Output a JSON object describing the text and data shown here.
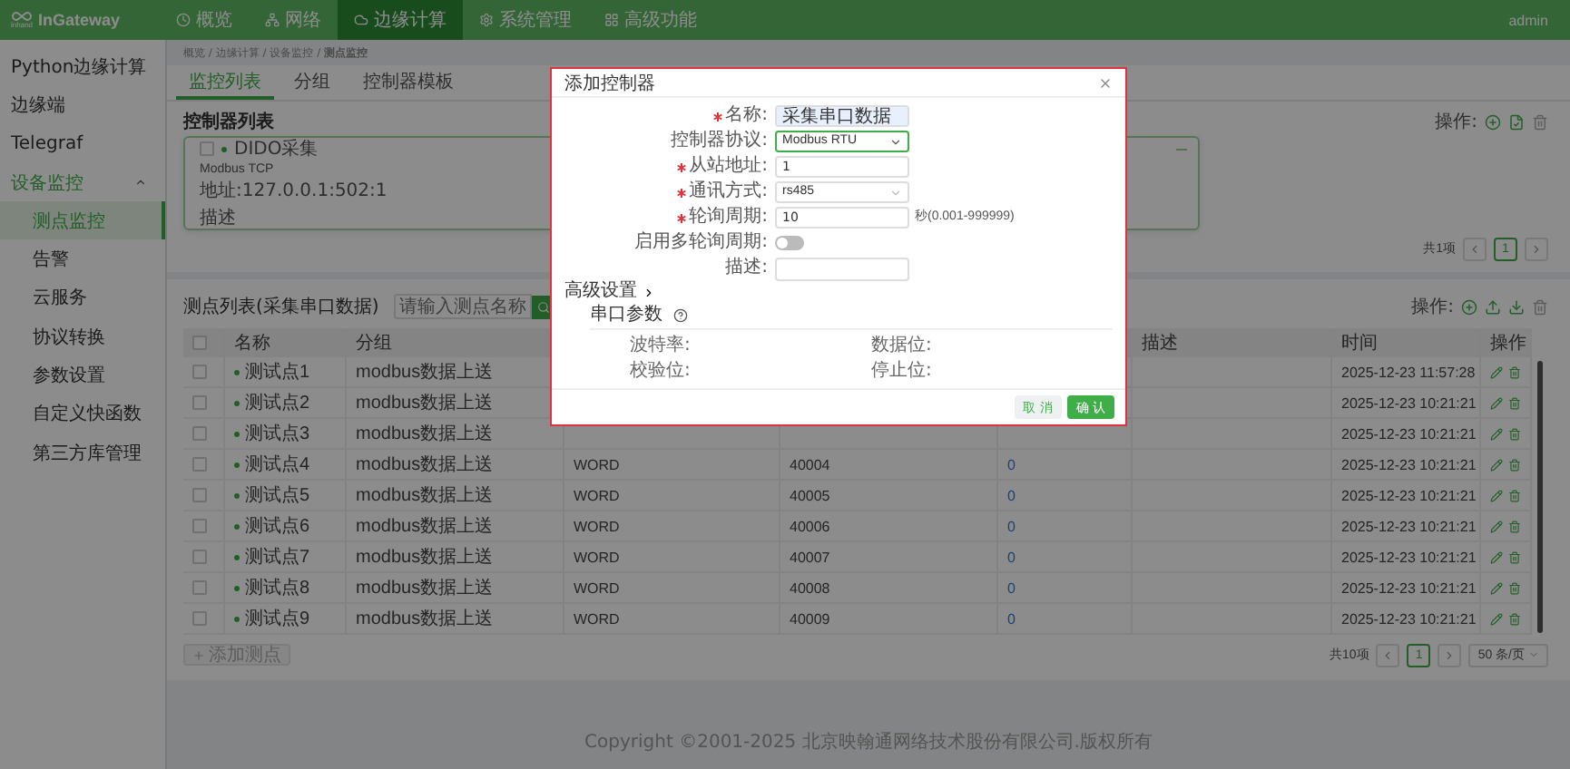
{
  "topbar": {
    "logo_sub": "inhand",
    "logo": "InGateway",
    "user": "admin",
    "nav": [
      {
        "label": "概览",
        "selected": false
      },
      {
        "label": "网络",
        "selected": false
      },
      {
        "label": "边缘计算",
        "selected": true
      },
      {
        "label": "系统管理",
        "selected": false
      },
      {
        "label": "高级功能",
        "selected": false
      }
    ]
  },
  "sidebar": {
    "items": [
      {
        "label": "Python边缘计算",
        "selected": false
      },
      {
        "label": "边缘端",
        "selected": false
      },
      {
        "label": "Telegraf",
        "selected": false
      },
      {
        "label": "设备监控",
        "selected": false,
        "expanded": true,
        "children": [
          {
            "label": "测点监控",
            "selected": true
          },
          {
            "label": "告警",
            "selected": false
          },
          {
            "label": "云服务",
            "selected": false
          },
          {
            "label": "协议转换",
            "selected": false
          },
          {
            "label": "参数设置",
            "selected": false
          },
          {
            "label": "自定义快函数",
            "selected": false
          },
          {
            "label": "第三方库管理",
            "selected": false
          }
        ]
      }
    ]
  },
  "breadcrumb": "概览 / 边缘计算 / 设备监控 / **测点监控**",
  "tabs": [
    {
      "label": "监控列表",
      "selected": true
    },
    {
      "label": "分组",
      "selected": false
    },
    {
      "label": "控制器模板",
      "selected": false
    }
  ],
  "controllers": {
    "title": "控制器列表",
    "actions_label": "操作:",
    "cards": [
      {
        "name": "DIDO采集",
        "protocol": "Modbus TCP",
        "address": "地址:127.0.0.1:502:1",
        "description": "描述",
        "checked": false
      }
    ],
    "pagination": {
      "total": "共1项",
      "pages": [
        {
          "label": "1",
          "selected": true
        }
      ]
    }
  },
  "points": {
    "title": "测点列表(采集串口数据)",
    "search": {
      "placeholder": "请输入测点名称"
    },
    "actions_label": "操作:",
    "all_checked": false,
    "columns": {
      "name": "名称",
      "group": "分组",
      "description": "描述",
      "time": "时间",
      "actions": "操作"
    },
    "rows": [
      {
        "name": "测试点1",
        "group": "modbus数据上送",
        "time": "2025-12-23 11:57:28",
        "checked": false
      },
      {
        "name": "测试点2",
        "group": "modbus数据上送",
        "time": "2025-12-23 10:21:21",
        "checked": false
      },
      {
        "name": "测试点3",
        "group": "modbus数据上送",
        "time": "2025-12-23 10:21:21",
        "checked": false
      },
      {
        "name": "测试点4",
        "group": "modbus数据上送",
        "column_3": "WORD",
        "column_4": "40004",
        "column_5": "0",
        "time": "2025-12-23 10:21:21",
        "checked": false
      },
      {
        "name": "测试点5",
        "group": "modbus数据上送",
        "column_3": "WORD",
        "column_4": "40005",
        "column_5": "0",
        "time": "2025-12-23 10:21:21",
        "checked": false
      },
      {
        "name": "测试点6",
        "group": "modbus数据上送",
        "column_3": "WORD",
        "column_4": "40006",
        "column_5": "0",
        "time": "2025-12-23 10:21:21",
        "checked": false
      },
      {
        "name": "测试点7",
        "group": "modbus数据上送",
        "column_3": "WORD",
        "column_4": "40007",
        "column_5": "0",
        "time": "2025-12-23 10:21:21",
        "checked": false
      },
      {
        "name": "测试点8",
        "group": "modbus数据上送",
        "column_3": "WORD",
        "column_4": "40008",
        "column_5": "0",
        "time": "2025-12-23 10:21:21",
        "checked": false
      },
      {
        "name": "测试点9",
        "group": "modbus数据上送",
        "column_3": "WORD",
        "column_4": "40009",
        "column_5": "0",
        "time": "2025-12-23 10:21:21",
        "checked": false
      }
    ],
    "add_button": "添加测点",
    "pagination": {
      "total": "共10项",
      "pages": [
        {
          "label": "1",
          "selected": true
        }
      ],
      "page_size": "50 条/页"
    }
  },
  "footer": "Copyright ©2001-2025 北京映翰通网络技术股份有限公司.版权所有",
  "modal": {
    "title": "添加控制器",
    "fields": [
      {
        "kind": "text",
        "label": "名称:",
        "required": true,
        "value": "采集串口数据",
        "highlighted": true,
        "focused": false
      },
      {
        "kind": "select",
        "label": "控制器协议:",
        "required": false,
        "value": "Modbus RTU",
        "highlighted": false,
        "focused": true
      },
      {
        "kind": "text",
        "label": "从站地址:",
        "required": true,
        "value": "1",
        "highlighted": false,
        "focused": false
      },
      {
        "kind": "select",
        "label": "通讯方式:",
        "required": true,
        "value": "rs485",
        "highlighted": false,
        "focused": false
      },
      {
        "kind": "text",
        "label": "轮询周期:",
        "required": true,
        "value": "10",
        "suffix": "秒(0.001-999999)",
        "highlighted": false,
        "focused": false
      },
      {
        "kind": "switch",
        "label": "启用多轮询周期:",
        "required": false,
        "on": false
      },
      {
        "kind": "textarea",
        "label": "描述:",
        "required": false,
        "highlighted": false,
        "focused": false
      }
    ],
    "advanced": "高级设置",
    "serial": {
      "title": "串口参数",
      "params": [
        "波特率:",
        "数据位:",
        "校验位:",
        "停止位:"
      ]
    },
    "buttons": [
      {
        "label": "取 消",
        "kind": "secondary"
      },
      {
        "label": "确 认",
        "kind": "primary"
      }
    ]
  }
}
